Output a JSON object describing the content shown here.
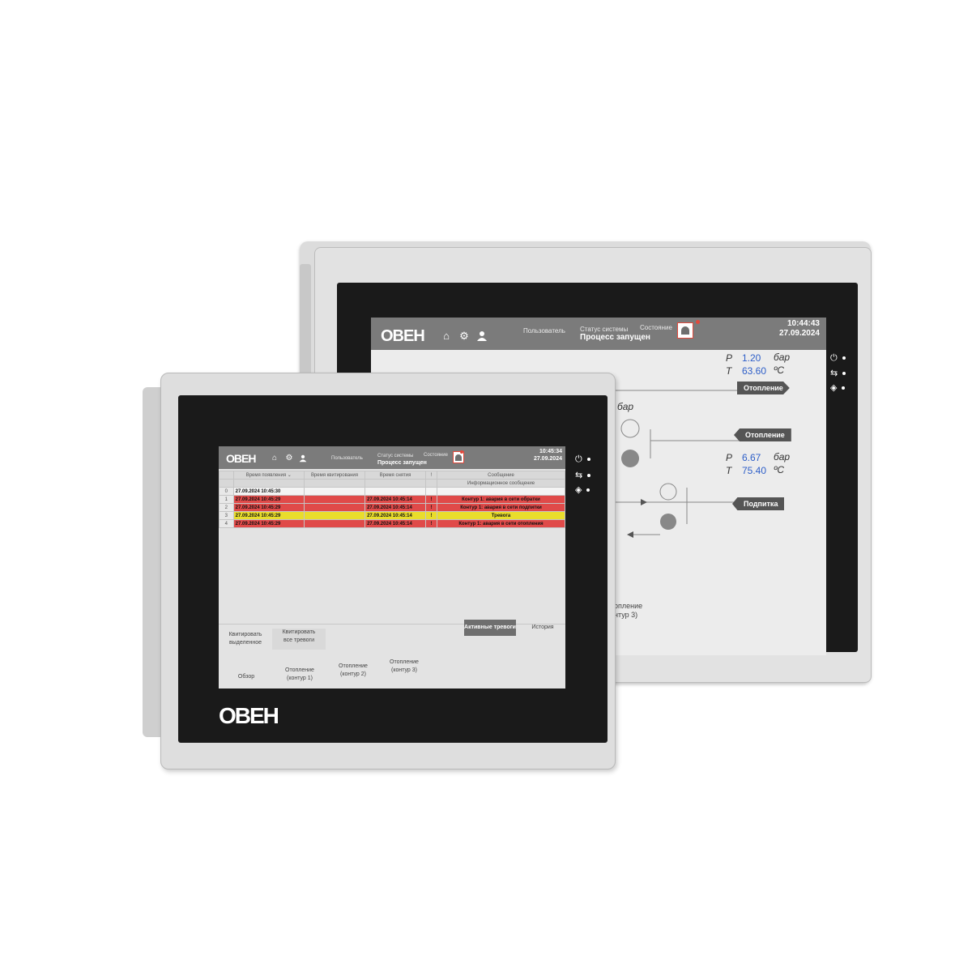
{
  "brand": {
    "logo": "ОВЕН"
  },
  "back_panel": {
    "header": {
      "user_label": "Пользователь",
      "status_label": "Статус системы",
      "status_value": "Процесс запущен",
      "state_label": "Состояние",
      "time": "10:44:43",
      "date": "27.09.2024"
    },
    "circuit1": {
      "p_label": "P",
      "p_value": "1.20",
      "p_unit": "бар",
      "t_label": "T",
      "t_value": "63.60",
      "t_unit": "ºC"
    },
    "circuit2": {
      "p_label": "P",
      "p_value": "6.67",
      "p_unit": "бар",
      "t_label": "T",
      "t_value": "75.40",
      "t_unit": "ºC"
    },
    "partial_unit": "бар",
    "tags": {
      "heating_out": "Отопление",
      "heating_in": "Отопление",
      "feed": "Подпитка"
    },
    "partial_nav": {
      "line1": "опление",
      "line2": "нтур 3)"
    }
  },
  "front_panel": {
    "header": {
      "user_label": "Пользователь",
      "status_label": "Статус системы",
      "status_value": "Процесс запущен",
      "state_label": "Состояние",
      "time": "10:45:34",
      "date": "27.09.2024"
    },
    "table": {
      "col_appear": "Время появления",
      "col_ack": "Время квитирования",
      "col_clear": "Время снятия",
      "col_message": "Сообщение",
      "col_info": "Информационное сообщение",
      "rows": [
        {
          "n": "0",
          "appear": "27.09.2024 10:45:30",
          "ack": "",
          "clear": "",
          "icon": "",
          "msg": ""
        },
        {
          "n": "1",
          "appear": "27.09.2024 10:45:29",
          "ack": "",
          "clear": "27.09.2024 10:45:14",
          "icon": "!",
          "msg": "Контур 1: авария в сети обратки"
        },
        {
          "n": "2",
          "appear": "27.09.2024 10:45:29",
          "ack": "",
          "clear": "27.09.2024 10:45:14",
          "icon": "!",
          "msg": "Контур 1: авария в сети подпитки"
        },
        {
          "n": "3",
          "appear": "27.09.2024 10:45:29",
          "ack": "",
          "clear": "27.09.2024 10:45:14",
          "icon": "!",
          "msg": "Тревога"
        },
        {
          "n": "4",
          "appear": "27.09.2024 10:45:29",
          "ack": "",
          "clear": "27.09.2024 10:45:14",
          "icon": "!",
          "msg": "Контур 1: авария в сети отопления"
        }
      ]
    },
    "buttons": {
      "ack_selected_1": "Квитировать",
      "ack_selected_2": "выделенное",
      "ack_all_1": "Квитировать",
      "ack_all_2": "все тревоги",
      "active_alarms": "Активные тревоги",
      "history": "История"
    },
    "nav": {
      "overview": "Обзор",
      "heat1_1": "Отопление",
      "heat1_2": "(контур 1)",
      "heat2_1": "Отопление",
      "heat2_2": "(контур 2)",
      "heat3_1": "Отопление",
      "heat3_2": "(контур 3)"
    }
  },
  "colors": {
    "alarm_red": "#e04a49",
    "warning_yellow": "#e9dd2c",
    "value_blue": "#2d5ec8",
    "header_gray": "#7b7b7b"
  }
}
